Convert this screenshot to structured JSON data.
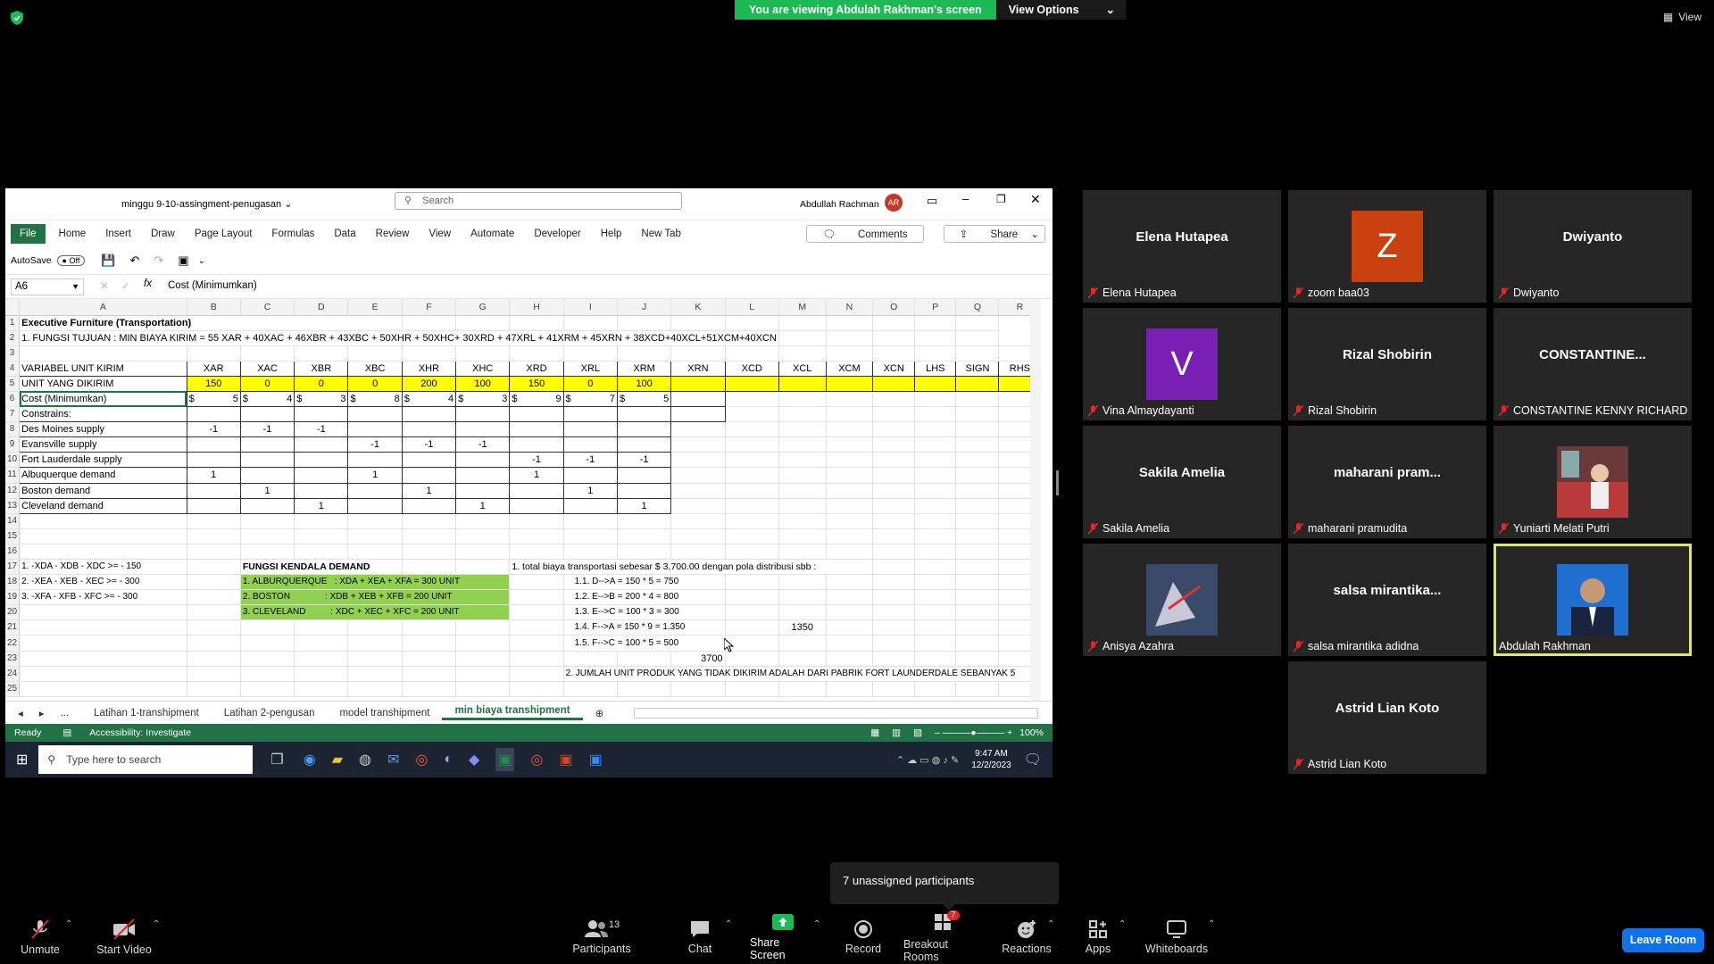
{
  "banner": {
    "viewing": "You are viewing Abdulah Rakhman's screen",
    "view_options": "View Options"
  },
  "top_view": "View",
  "excel": {
    "file_title": "minggu 9-10-assingment-penugasan",
    "search_placeholder": "Search",
    "user": "Abdullah Rachman",
    "user_initials": "AR",
    "ribbon_tabs": [
      "File",
      "Home",
      "Insert",
      "Draw",
      "Page Layout",
      "Formulas",
      "Data",
      "Review",
      "View",
      "Automate",
      "Developer",
      "Help",
      "New Tab"
    ],
    "comments": "Comments",
    "share": "Share",
    "autosave": "AutoSave",
    "autosave_state": "Off",
    "name_box": "A6",
    "formula": "Cost (Minimumkan)",
    "columns": [
      "A",
      "B",
      "C",
      "D",
      "E",
      "F",
      "G",
      "H",
      "I",
      "J",
      "K",
      "L",
      "M",
      "N",
      "O",
      "P",
      "Q",
      "R"
    ],
    "r1": "Executive Furniture (Transportation)",
    "r2": "1. FUNGSI TUJUAN : MIN BIAYA KIRIM = 55 XAR + 40XAC + 46XBR + 43XBC + 50XHR + 50XHC+ 30XRD + 47XRL + 41XRM + 45XRN + 38XCD+40XCL+51XCM+40XCN",
    "r4": [
      "VARIABEL UNIT KIRIM",
      "XAR",
      "XAC",
      "XBR",
      "XBC",
      "XHR",
      "XHC",
      "XRD",
      "XRL",
      "XRM",
      "XRN",
      "XCD",
      "XCL",
      "XCM",
      "XCN",
      "LHS",
      "SIGN",
      "RHS"
    ],
    "r5": [
      "UNIT YANG DIKIRIM",
      "150",
      "0",
      "0",
      "0",
      "200",
      "100",
      "150",
      "0",
      "100"
    ],
    "r6_label": "Cost (Minimumkan)",
    "r6_costs": [
      "5",
      "4",
      "3",
      "8",
      "4",
      "3",
      "9",
      "7",
      "5"
    ],
    "dollar": "$",
    "r7": "Constrains:",
    "r8": "Des Moines supply",
    "r9": "Evansville supply",
    "r10": "Fort Lauderdale supply",
    "r11": "Albuquerque demand",
    "r12": "Boston demand",
    "r13": "Cleveland demand",
    "neg1": "-1",
    "one": "1",
    "left_list": [
      "1. -XDA - XDB - XDC >= - 150",
      "2. -XEA - XEB - XEC >= - 300",
      "3. -XFA - XFB - XFC >= - 300"
    ],
    "demand_title": "FUNGSI KENDALA DEMAND",
    "demand_list": [
      "1. ALBURQUERQUE   : XDA + XEA + XFA = 300 UNIT",
      "2. BOSTON              : XDB + XEB + XFB = 200 UNIT",
      "3. CLEVELAND          : XDC + XEC + XFC = 200 UNIT"
    ],
    "notes_title": "1. total biaya transportasi sebesar $ 3,700.00 dengan pola distribusi sbb :",
    "notes": [
      "1.1. D-->A = 150 * 5 = 750",
      "1.2. E-->B = 200 * 4 = 800",
      "1.3. E-->C = 100 * 3 = 300",
      "1.4. F-->A = 150 * 9 = 1.350",
      "1.5. F-->C = 100 * 5 = 500"
    ],
    "m21": "1350",
    "k23": "3700",
    "r24": "2. JUMLAH UNIT PRODUK YANG TIDAK DIKIRIM ADALAH DARI PABRIK FORT LAUNDERDALE SEBANYAK 5",
    "sheet_tabs": [
      "...",
      "Latihan 1-transhipment",
      "Latihan 2-pengusan",
      "model transhipment",
      "min biaya transhipment"
    ],
    "status_ready": "Ready",
    "accessibility": "Accessibility: Investigate",
    "zoom": "100%",
    "taskbar_search": "Type here to search",
    "time": "9:47 AM",
    "date": "12/2/2023"
  },
  "participants": [
    {
      "name": "Elena Hutapea",
      "label": "Elena Hutapea"
    },
    {
      "name": "Z",
      "label": "zoom baa03",
      "color": "#c8410f"
    },
    {
      "name": "Dwiyanto",
      "label": "Dwiyanto"
    },
    {
      "name": "V",
      "label": "Vina Almaydayanti",
      "color": "#7a1fb3"
    },
    {
      "name": "Rizal Shobirin",
      "label": "Rizal Shobirin"
    },
    {
      "name": "CONSTANTINE...",
      "label": "CONSTANTINE KENNY RICHARD"
    },
    {
      "name": "Sakila Amelia",
      "label": "Sakila Amelia"
    },
    {
      "name": "maharani pram...",
      "label": "maharani pramudita"
    },
    {
      "name": "",
      "label": "Yuniarti Melati Putri"
    },
    {
      "name": "",
      "label": "Anisya Azahra"
    },
    {
      "name": "salsa mirantika...",
      "label": "salsa mirantika adidna"
    },
    {
      "name": "",
      "label": "Abdulah Rakhman"
    },
    {
      "name": "Astrid Lian Koto",
      "label": "Astrid Lian Koto"
    }
  ],
  "tooltip": "7 unassigned participants",
  "toolbar": {
    "unmute": "Unmute",
    "start_video": "Start Video",
    "participants": "Participants",
    "participants_count": "13",
    "chat": "Chat",
    "share_screen": "Share Screen",
    "record": "Record",
    "breakout": "Breakout Rooms",
    "breakout_badge": "7",
    "reactions": "Reactions",
    "apps": "Apps",
    "whiteboards": "Whiteboards",
    "leave": "Leave Room"
  }
}
